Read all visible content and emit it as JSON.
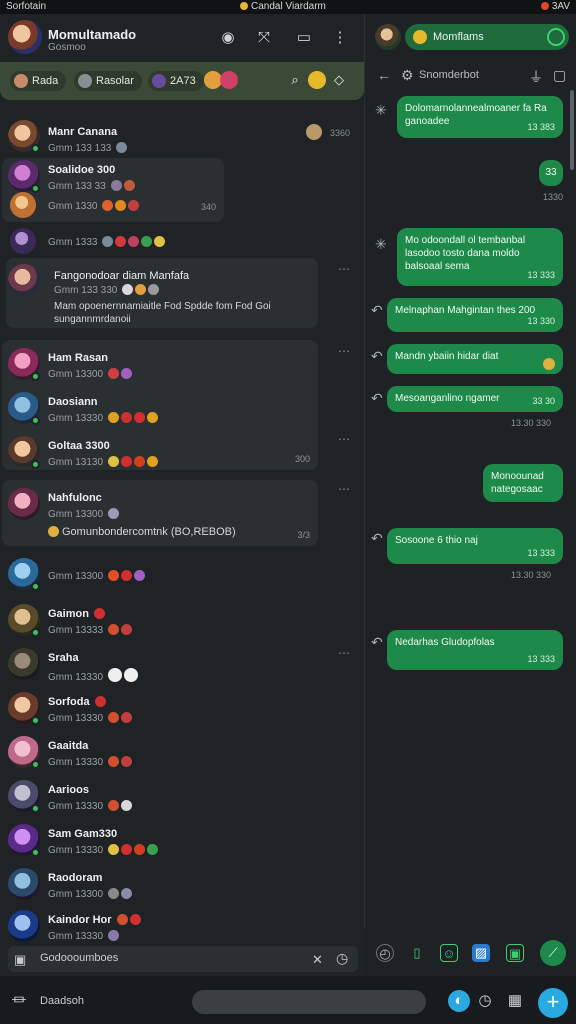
{
  "status": {
    "left": "Sorfotain",
    "center": "Candal Viardarm",
    "right": "3AV"
  },
  "left_header": {
    "title": "Momultamado",
    "subtitle": "Gosmoo"
  },
  "filters": {
    "chip1": "Rada",
    "chip2": "Rasolar",
    "chip3": "2A73"
  },
  "chats": [
    {
      "name": "Manr Canana",
      "preview": "Gmm 133 133",
      "time": "3360"
    },
    {
      "name": "Soalidoe 300",
      "preview": "Gmm 133 33",
      "time": ""
    },
    {
      "name": "",
      "preview": "Gmm 1330",
      "time": "340"
    },
    {
      "name": "",
      "preview": "Gmm 1333",
      "time": ""
    },
    {
      "name": "Fangonodoar diam Manfafa",
      "preview": "Gmm 133 330",
      "text": "Mam opoenernnamiaitle Fod Spdde fom Fod Goi sungannmrdanoii",
      "time": ""
    },
    {
      "name": "Ham Rasan",
      "preview": "Gmm 13300",
      "time": ""
    },
    {
      "name": "Daosiann",
      "preview": "Gmm 13330",
      "time": ""
    },
    {
      "name": "Goltaa 3300",
      "preview": "Gmm 13130",
      "time": "300"
    },
    {
      "name": "Nahfulonc",
      "preview": "Gmm 13300",
      "text": "Gomunbondercomtnk (BO,REBOB)",
      "time": "3/3"
    },
    {
      "name": "",
      "preview": "Gmm 13300",
      "time": ""
    },
    {
      "name": "Gaimon",
      "preview": "Gmm 13333",
      "time": ""
    },
    {
      "name": "Sraha",
      "preview": "Gmm 13330",
      "time": ""
    },
    {
      "name": "Sorfoda",
      "preview": "Gmm 13330",
      "time": ""
    },
    {
      "name": "Gaaitda",
      "preview": "Gmm 13330",
      "time": ""
    },
    {
      "name": "Aarioos",
      "preview": "Gmm 13330",
      "time": ""
    },
    {
      "name": "Sam Gam330",
      "preview": "Gmm 13330",
      "time": ""
    },
    {
      "name": "Raodoram",
      "preview": "Gmm 13300",
      "time": ""
    },
    {
      "name": "Kaindor Hor",
      "preview": "Gmm 13330",
      "time": ""
    }
  ],
  "left_search": {
    "placeholder": "Godoooumboes"
  },
  "right_header": {
    "title": "Momflams"
  },
  "right_sub": {
    "title": "Snomderbot"
  },
  "messages": [
    {
      "text": "Dolomarnolannealmoaner fa Ra ganoadee",
      "time": "13 383"
    },
    {
      "text": "33",
      "time": ""
    },
    {
      "text": "Mo odoondall ol tembanbal lasodoo tosto dana moldo balsoaal sema",
      "time": "13 333"
    },
    {
      "text": "Melnaphan Mahgintan thes 200",
      "time": "13 330"
    },
    {
      "text": "Mandn ybaiin hidar diat",
      "time": ""
    },
    {
      "text": "Mesoanganlino ngamer",
      "time": "33 30"
    },
    {
      "text": "Monoounad nategosaac",
      "time": ""
    },
    {
      "text": "Sosoone 6 thio naj",
      "time": "13 333"
    },
    {
      "text": "Nedarhas Gludopfolas",
      "time": "13 333"
    }
  ],
  "out_times": [
    "1330",
    "13.30 330",
    "13.30 330",
    "13.30 330"
  ],
  "bottom": {
    "label": "Daadsoh"
  },
  "colors": {
    "accent": "#1e8a4a",
    "filter_bar": "#3a4a36",
    "fab": "#2aa8e0"
  }
}
